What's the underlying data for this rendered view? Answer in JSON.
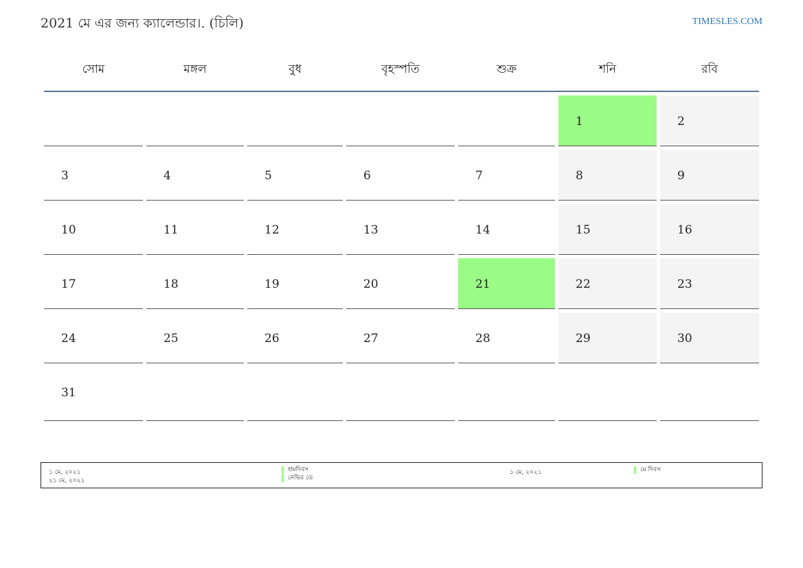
{
  "header": {
    "title": "2021 মে এর জন্য ক্যালেন্ডার।. (চিলি)",
    "site": "TIMESLES.COM"
  },
  "weekdays": [
    "সোম",
    "মঙ্গল",
    "বুধ",
    "বৃহস্পতি",
    "শুক্র",
    "শনি",
    "রবি"
  ],
  "weeks": [
    [
      "",
      "",
      "",
      "",
      "",
      "1",
      "2"
    ],
    [
      "3",
      "4",
      "5",
      "6",
      "7",
      "8",
      "9"
    ],
    [
      "10",
      "11",
      "12",
      "13",
      "14",
      "15",
      "16"
    ],
    [
      "17",
      "18",
      "19",
      "20",
      "21",
      "22",
      "23"
    ],
    [
      "24",
      "25",
      "26",
      "27",
      "28",
      "29",
      "30"
    ],
    [
      "31",
      "",
      "",
      "",
      "",
      "",
      ""
    ]
  ],
  "holiday_days": [
    "1",
    "21"
  ],
  "colors": {
    "holiday": "#9afc86",
    "weekend": "#f4f4f4",
    "header_rule": "#5b7391",
    "link": "#2e75b6"
  },
  "legend": {
    "left": [
      {
        "date": "১ মে, ২০২১",
        "name": "শ্রমদিবস"
      },
      {
        "date": "২১ মে, ২০২১",
        "name": "নেভির ডে"
      }
    ],
    "right": [
      {
        "date": "১ মে, ২০২১",
        "name": "মে দিবস"
      }
    ]
  }
}
